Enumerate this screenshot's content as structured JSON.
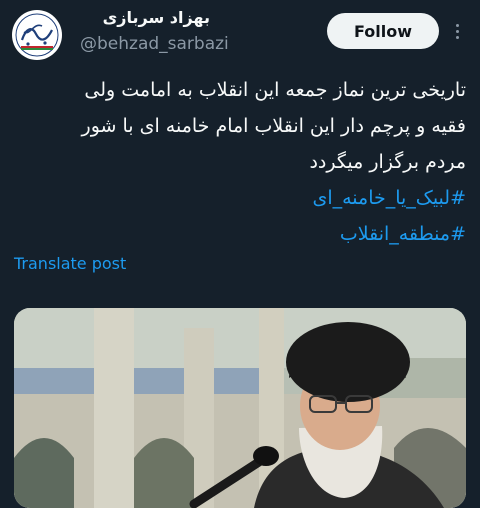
{
  "author": {
    "display_name": "بهزاد سربازی",
    "handle": "@behzad_sarbazi",
    "avatar_icon": "calligraphy-avatar-icon"
  },
  "actions": {
    "follow_label": "Follow",
    "more_icon": "more-vertical-icon"
  },
  "tweet": {
    "lines": [
      "تاریخی ترین نماز جمعه این انقلاب به امامت ولی",
      "فقیه و پرچم دار این انقلاب امام خامنه ای با شور",
      "مردم برگزار میگردد"
    ],
    "hashtags": [
      "#لبیک_یا_خامنه_ای",
      "#منطقه_انقلاب"
    ]
  },
  "translate_label": "Translate post",
  "colors": {
    "background": "#15202b",
    "text": "#f7f9f9",
    "secondary": "#8b98a5",
    "accent": "#1d9bf0",
    "button": "#eff3f4"
  }
}
